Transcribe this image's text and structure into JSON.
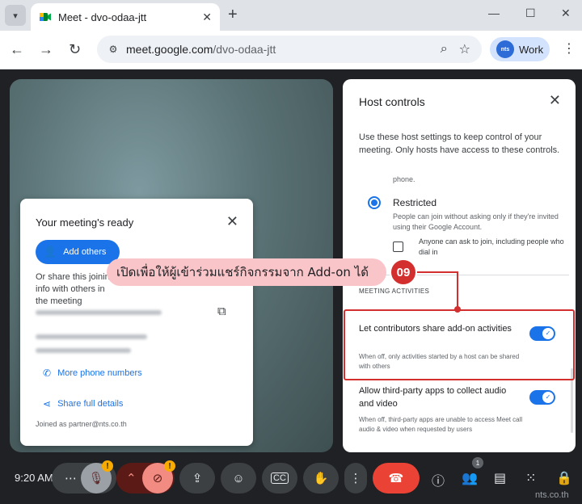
{
  "browser": {
    "tab_title": "Meet - dvo-odaa-jtt",
    "url_host": "meet.google.com",
    "url_path": "/dvo-odaa-jtt",
    "profile_initials": "nts",
    "profile_label": "Work"
  },
  "ready_card": {
    "title": "Your meeting's ready",
    "add_others_label": "Add others",
    "share_text": "Or share this joining info with others in the meeting",
    "more_phone_numbers": "More phone numbers",
    "share_full_details": "Share full details",
    "joined_as": "Joined as partner@nts.co.th"
  },
  "host_controls": {
    "title": "Host controls",
    "description": "Use these host settings to keep control of your meeting. Only hosts have access to these controls.",
    "truncated_text": "phone.",
    "restricted_title": "Restricted",
    "restricted_desc": "People can join without asking only if they're invited using their Google Account.",
    "ask_to_join_label": "Anyone can ask to join, including people who dial in",
    "section_label": "MEETING ACTIVITIES",
    "addon_title": "Let contributors share add-on activities",
    "addon_desc": "When off, only activities started by a host can be shared with others",
    "thirdparty_title": "Allow third-party apps to collect audio and video",
    "thirdparty_desc": "When off, third-party apps are unable to access Meet call audio & video when requested by users"
  },
  "annotation": {
    "callout_text": "เปิดเพื่อให้ผู้เข้าร่วมแชร์กิจกรรมจาก Add-on ได้",
    "step_number": "09"
  },
  "meet_bar": {
    "time": "9:20 AM",
    "people_count": "1"
  },
  "watermark": "nts.co.th",
  "colors": {
    "accent_blue": "#1a73e8",
    "annotation_red": "#d32f2f",
    "callout_pink": "#f9c5c9",
    "end_call_red": "#ea4335"
  }
}
